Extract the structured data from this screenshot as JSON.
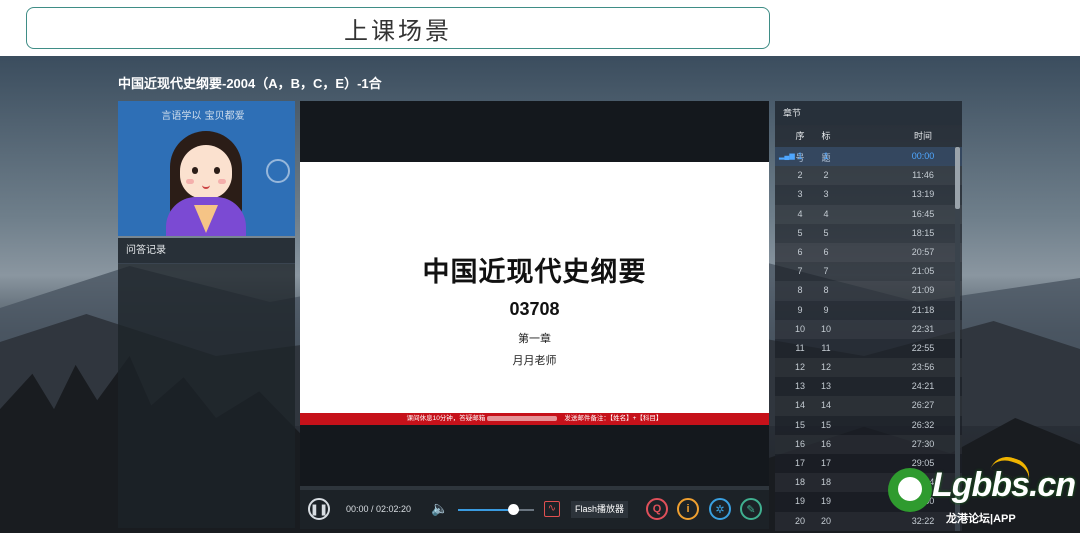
{
  "banner": {
    "title": "上课场景"
  },
  "course": {
    "title": "中国近现代史纲要-2004（A，B，C，E）-1合"
  },
  "teacher_video": {
    "handwriting": "言语学以 宝贝都爱"
  },
  "qa_panel": {
    "title": "问答记录"
  },
  "slide": {
    "title": "中国近现代史纲要",
    "code": "03708",
    "chapter": "第一章",
    "teacher": "月月老师",
    "notice_left": "课间休息10分钟，答疑邮箱",
    "notice_right": "发送邮件备注：【姓名】+【科目】"
  },
  "player": {
    "time": "00:00 / 02:02:20",
    "flash_label": "Flash播放器",
    "accent": "#3a9be0",
    "volume_fraction": 0.73,
    "icons": [
      "pause-icon",
      "volume-icon",
      "flash-icon",
      "qa-icon",
      "info-icon",
      "settings-icon",
      "pen-icon"
    ]
  },
  "chapters": {
    "title": "章节",
    "headers": {
      "no": "序号",
      "title": "标题",
      "time": "时间"
    },
    "rows": [
      {
        "no": "1",
        "title": "1",
        "time": "00:00"
      },
      {
        "no": "2",
        "title": "2",
        "time": "11:46"
      },
      {
        "no": "3",
        "title": "3",
        "time": "13:19"
      },
      {
        "no": "4",
        "title": "4",
        "time": "16:45"
      },
      {
        "no": "5",
        "title": "5",
        "time": "18:15"
      },
      {
        "no": "6",
        "title": "6",
        "time": "20:57"
      },
      {
        "no": "7",
        "title": "7",
        "time": "21:05"
      },
      {
        "no": "8",
        "title": "8",
        "time": "21:09"
      },
      {
        "no": "9",
        "title": "9",
        "time": "21:18"
      },
      {
        "no": "10",
        "title": "10",
        "time": "22:31"
      },
      {
        "no": "11",
        "title": "11",
        "time": "22:55"
      },
      {
        "no": "12",
        "title": "12",
        "time": "23:56"
      },
      {
        "no": "13",
        "title": "13",
        "time": "24:21"
      },
      {
        "no": "14",
        "title": "14",
        "time": "26:27"
      },
      {
        "no": "15",
        "title": "15",
        "time": "26:32"
      },
      {
        "no": "16",
        "title": "16",
        "time": "27:30"
      },
      {
        "no": "17",
        "title": "17",
        "time": "29:05"
      },
      {
        "no": "18",
        "title": "18",
        "time": "30:14"
      },
      {
        "no": "19",
        "title": "19",
        "time": "31:50"
      },
      {
        "no": "20",
        "title": "20",
        "time": "32:22"
      }
    ],
    "active_index": 0
  },
  "watermark": {
    "brand": "Lgbbs.cn",
    "sub": "龙港论坛|APP"
  }
}
